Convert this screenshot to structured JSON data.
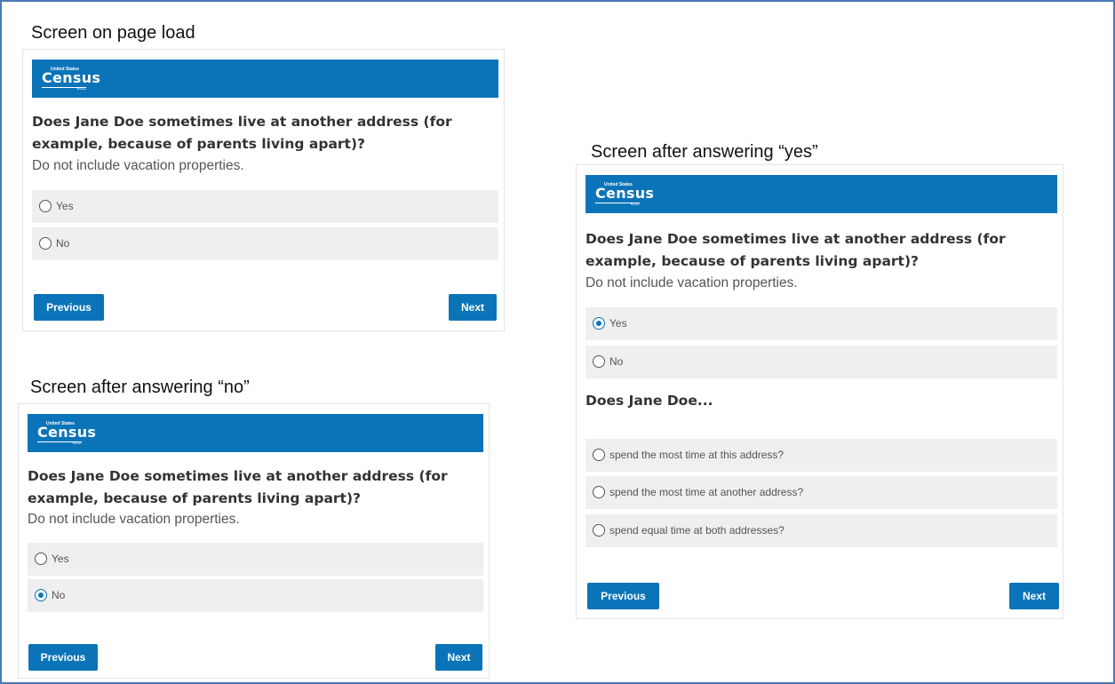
{
  "captions": {
    "load": "Screen on page load",
    "no": "Screen after answering “no”",
    "yes": "Screen after answering “yes”"
  },
  "logo": {
    "top": "United States",
    "main": "Census",
    "sub": "Bureau"
  },
  "question": "Does Jane Doe sometimes live at another address (for example, because of parents living apart)?",
  "hint": "Do not include vacation properties.",
  "options": {
    "yes": "Yes",
    "no": "No"
  },
  "followup": {
    "title": "Does Jane Doe...",
    "options": [
      "spend the most time at this address?",
      "spend the most time at another address?",
      "spend equal time at both addresses?"
    ]
  },
  "buttons": {
    "previous": "Previous",
    "next": "Next"
  },
  "colors": {
    "brand": "#0b74b8",
    "frame": "#4a78b5",
    "option_bg": "#efefef"
  },
  "states": {
    "load": "none",
    "no_screen": "No",
    "yes_screen": "Yes"
  }
}
